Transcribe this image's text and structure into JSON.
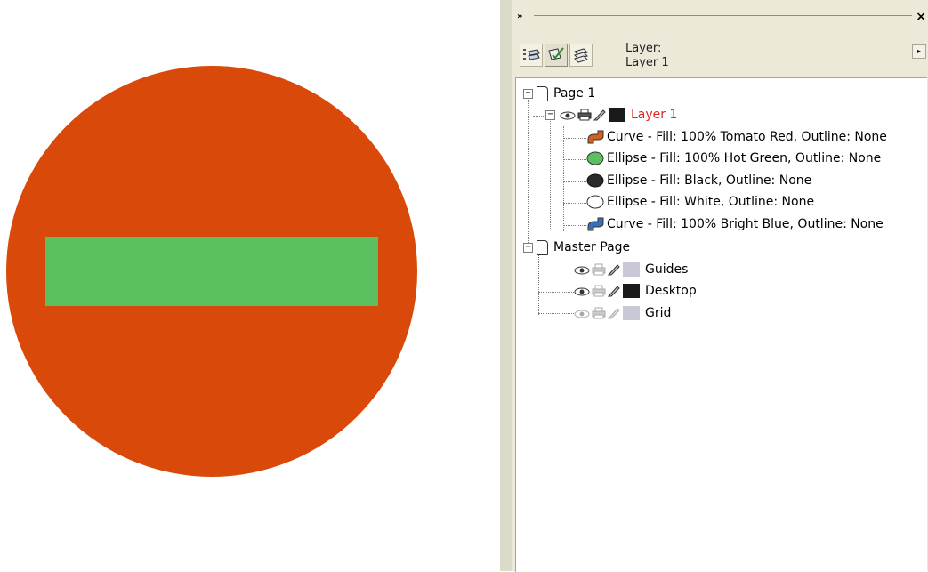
{
  "canvas": {
    "disc_color": "#d94a0a",
    "bar_color": "#5cbf60"
  },
  "docker": {
    "dock_arrows": "»",
    "close_glyph": "×",
    "layer_label": "Layer:",
    "layer_name": "Layer 1",
    "menu_arrow": "▸",
    "toolbar_icons": [
      "object-manager-layers-icon",
      "object-properties-icon",
      "layer-manager-icon"
    ]
  },
  "tree": {
    "page1": {
      "label": "Page 1",
      "layer1": {
        "label": "Layer 1",
        "color": "#e02424",
        "swatch": "#1a1a1a",
        "objects": [
          {
            "label": "Curve - Fill: 100% Tomato Red, Outline: None",
            "icon": "curve-red-icon"
          },
          {
            "label": "Ellipse - Fill: 100% Hot Green, Outline: None",
            "icon": "ellipse-green-icon",
            "fill": "#5cbf60"
          },
          {
            "label": "Ellipse - Fill: Black, Outline: None",
            "icon": "ellipse-black-icon",
            "fill": "#2a2a2a"
          },
          {
            "label": "Ellipse - Fill: White, Outline: None",
            "icon": "ellipse-white-icon",
            "fill": "#ffffff"
          },
          {
            "label": "Curve - Fill: 100% Bright Blue, Outline: None",
            "icon": "curve-blue-icon"
          }
        ]
      }
    },
    "master": {
      "label": "Master Page",
      "layers": [
        {
          "label": "Guides",
          "swatch": "#c9c9d6"
        },
        {
          "label": "Desktop",
          "swatch": "#1a1a1a"
        },
        {
          "label": "Grid",
          "swatch": "#c9c9d6"
        }
      ]
    }
  }
}
